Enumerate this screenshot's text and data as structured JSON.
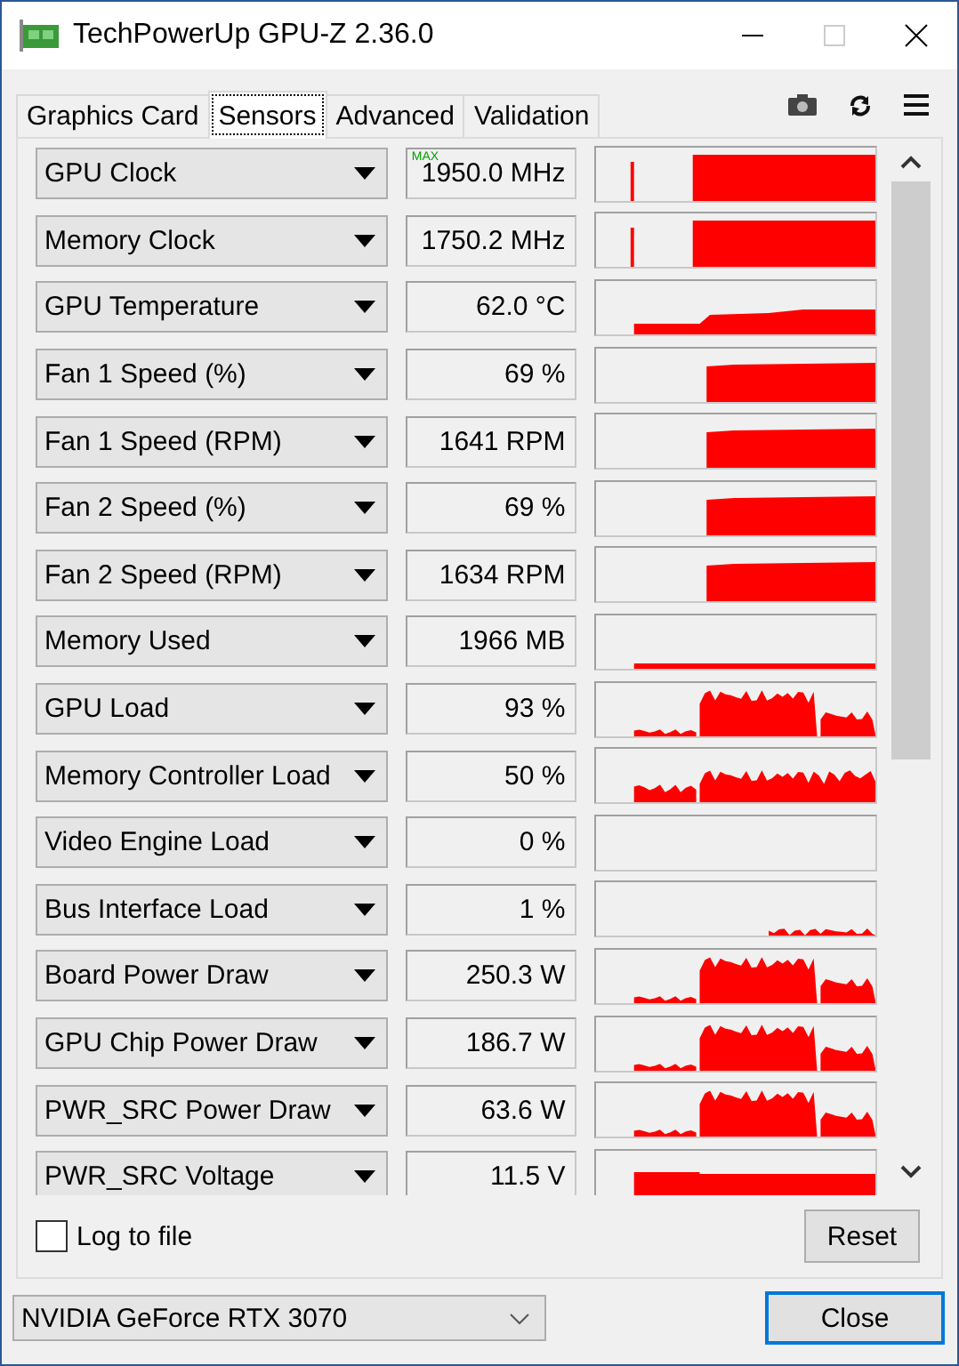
{
  "window": {
    "title": "TechPowerUp GPU-Z 2.36.0"
  },
  "tabs": [
    {
      "label": "Graphics Card",
      "selected": false
    },
    {
      "label": "Sensors",
      "selected": true
    },
    {
      "label": "Advanced",
      "selected": false
    },
    {
      "label": "Validation",
      "selected": false
    }
  ],
  "sensors": [
    {
      "name": "GPU Clock",
      "badge": "MAX",
      "value": "1950.0 MHz",
      "kind": "clock"
    },
    {
      "name": "Memory Clock",
      "value": "1750.2 MHz",
      "kind": "clock"
    },
    {
      "name": "GPU Temperature",
      "value": "62.0 °C",
      "kind": "temperature"
    },
    {
      "name": "Fan 1 Speed (%)",
      "value": "69 %",
      "kind": "fan"
    },
    {
      "name": "Fan 1 Speed (RPM)",
      "value": "1641 RPM",
      "kind": "fan"
    },
    {
      "name": "Fan 2 Speed (%)",
      "value": "69 %",
      "kind": "fan"
    },
    {
      "name": "Fan 2 Speed (RPM)",
      "value": "1634 RPM",
      "kind": "fan"
    },
    {
      "name": "Memory Used",
      "value": "1966 MB",
      "kind": "memory"
    },
    {
      "name": "GPU Load",
      "value": "93 %",
      "kind": "load"
    },
    {
      "name": "Memory Controller Load",
      "value": "50 %",
      "kind": "controller"
    },
    {
      "name": "Video Engine Load",
      "value": "0 %",
      "kind": "idle"
    },
    {
      "name": "Bus Interface Load",
      "value": "1 %",
      "kind": "bus"
    },
    {
      "name": "Board Power Draw",
      "value": "250.3 W",
      "kind": "load"
    },
    {
      "name": "GPU Chip Power Draw",
      "value": "186.7 W",
      "kind": "load"
    },
    {
      "name": "PWR_SRC Power Draw",
      "value": "63.6 W",
      "kind": "load"
    },
    {
      "name": "PWR_SRC Voltage",
      "value": "11.5 V",
      "kind": "voltage"
    }
  ],
  "log_to_file": {
    "label": "Log to file",
    "checked": false
  },
  "reset_button": "Reset",
  "gpu_select": {
    "value": "NVIDIA GeForce RTX 3070"
  },
  "close_button": "Close"
}
